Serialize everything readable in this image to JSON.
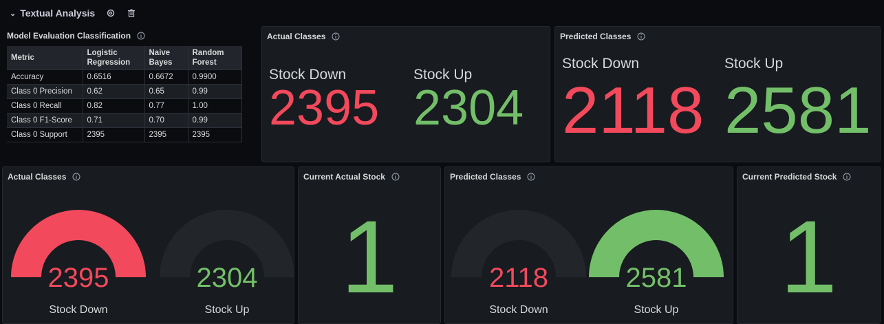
{
  "row": {
    "title": "Textual Analysis",
    "chevron": "chevron-down-icon",
    "settings_icon": "gear-icon",
    "delete_icon": "trash-icon"
  },
  "colors": {
    "red": "#f2495c",
    "green": "#73bf69",
    "track": "#22252a",
    "panel_bg": "#181b1f"
  },
  "model_eval": {
    "title": "Model Evaluation Classification",
    "columns": [
      "Metric",
      "Logistic Regression",
      "Naive Bayes",
      "Random Forest"
    ],
    "rows": [
      [
        "Accuracy",
        "0.6516",
        "0.6672",
        "0.9900"
      ],
      [
        "Class 0 Precision",
        "0.62",
        "0.65",
        "0.99"
      ],
      [
        "Class 0 Recall",
        "0.82",
        "0.77",
        "1.00"
      ],
      [
        "Class 0 F1-Score",
        "0.71",
        "0.70",
        "0.99"
      ],
      [
        "Class 0 Support",
        "2395",
        "2395",
        "2395"
      ]
    ]
  },
  "actual_stats": {
    "title": "Actual Classes",
    "items": [
      {
        "label": "Stock Down",
        "value": "2395",
        "color": "red"
      },
      {
        "label": "Stock Up",
        "value": "2304",
        "color": "green"
      }
    ]
  },
  "predicted_stats": {
    "title": "Predicted Classes",
    "items": [
      {
        "label": "Stock Down",
        "value": "2118",
        "color": "red"
      },
      {
        "label": "Stock Up",
        "value": "2581",
        "color": "green"
      }
    ]
  },
  "actual_gauges": {
    "title": "Actual Classes",
    "gauges": [
      {
        "label": "Stock Down",
        "value": "2395",
        "fill_fraction": 1.0,
        "color": "red"
      },
      {
        "label": "Stock Up",
        "value": "2304",
        "fill_fraction": 0.0,
        "color": "green"
      }
    ]
  },
  "current_actual": {
    "title": "Current Actual Stock",
    "value": "1"
  },
  "predicted_gauges": {
    "title": "Predicted Classes",
    "gauges": [
      {
        "label": "Stock Down",
        "value": "2118",
        "fill_fraction": 0.0,
        "color": "red"
      },
      {
        "label": "Stock Up",
        "value": "2581",
        "fill_fraction": 1.0,
        "color": "green"
      }
    ]
  },
  "current_predicted": {
    "title": "Current Predicted Stock",
    "value": "1"
  }
}
